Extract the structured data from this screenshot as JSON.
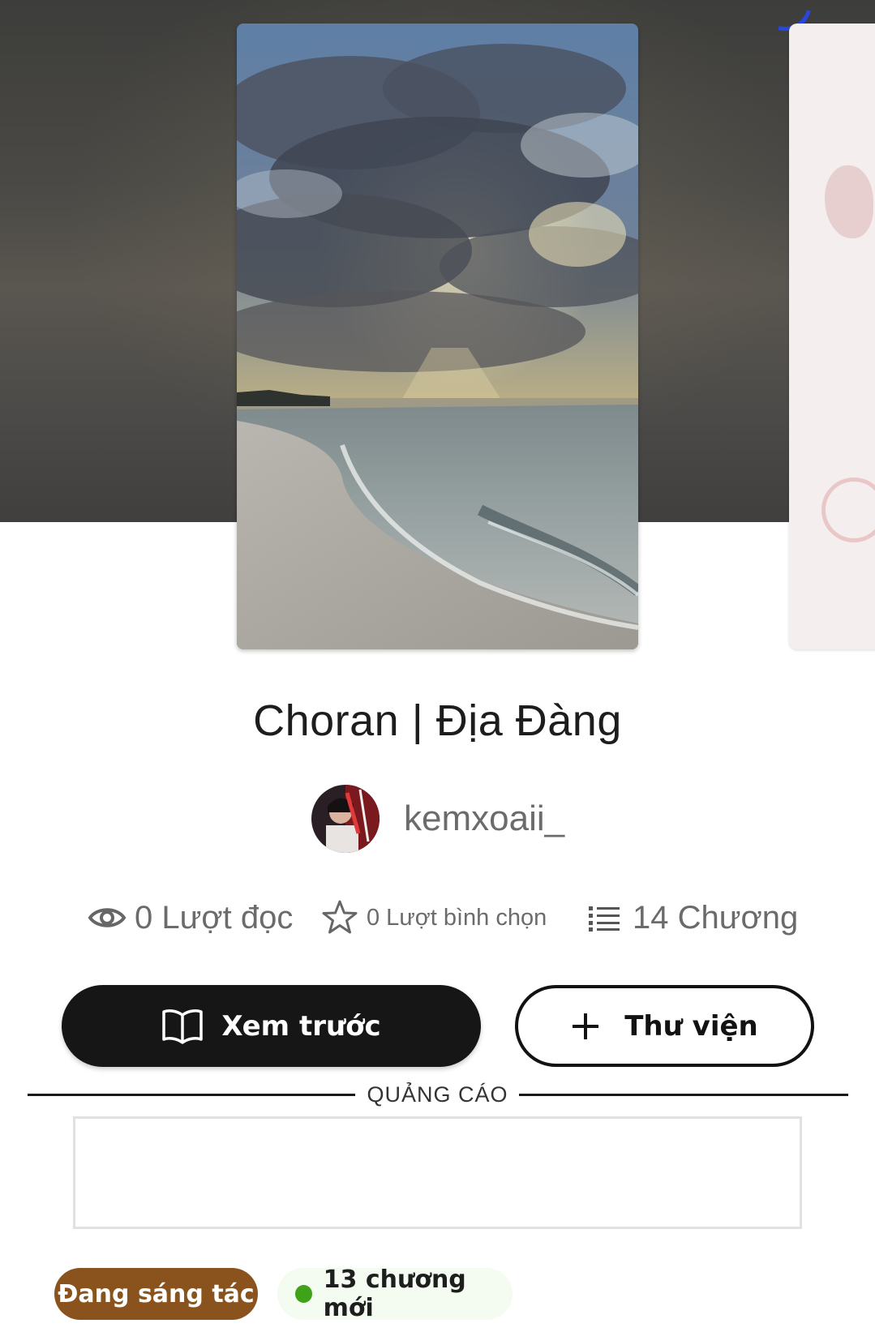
{
  "book": {
    "title": "Choran | Địa Đàng",
    "author": "kemxoaii_"
  },
  "stats": {
    "reads": "0 Lượt đọc",
    "votes": "0 Lượt bình chọn",
    "chapters": "14 Chương"
  },
  "actions": {
    "preview_label": "Xem trước",
    "library_label": "Thư viện"
  },
  "ad": {
    "label": "QUẢNG CÁO"
  },
  "tags": {
    "status": "Đang sáng tác",
    "new_chapters": "13 chương mới"
  },
  "icons": {
    "reads": "eye-icon",
    "votes": "star-icon",
    "chapters": "list-icon",
    "preview": "open-book-icon",
    "library": "plus-icon"
  },
  "colors": {
    "primary_button": "#161616",
    "status_pill": "#8a531d",
    "new_dot": "#3fa319",
    "loading_arc": "#2a46e0"
  }
}
